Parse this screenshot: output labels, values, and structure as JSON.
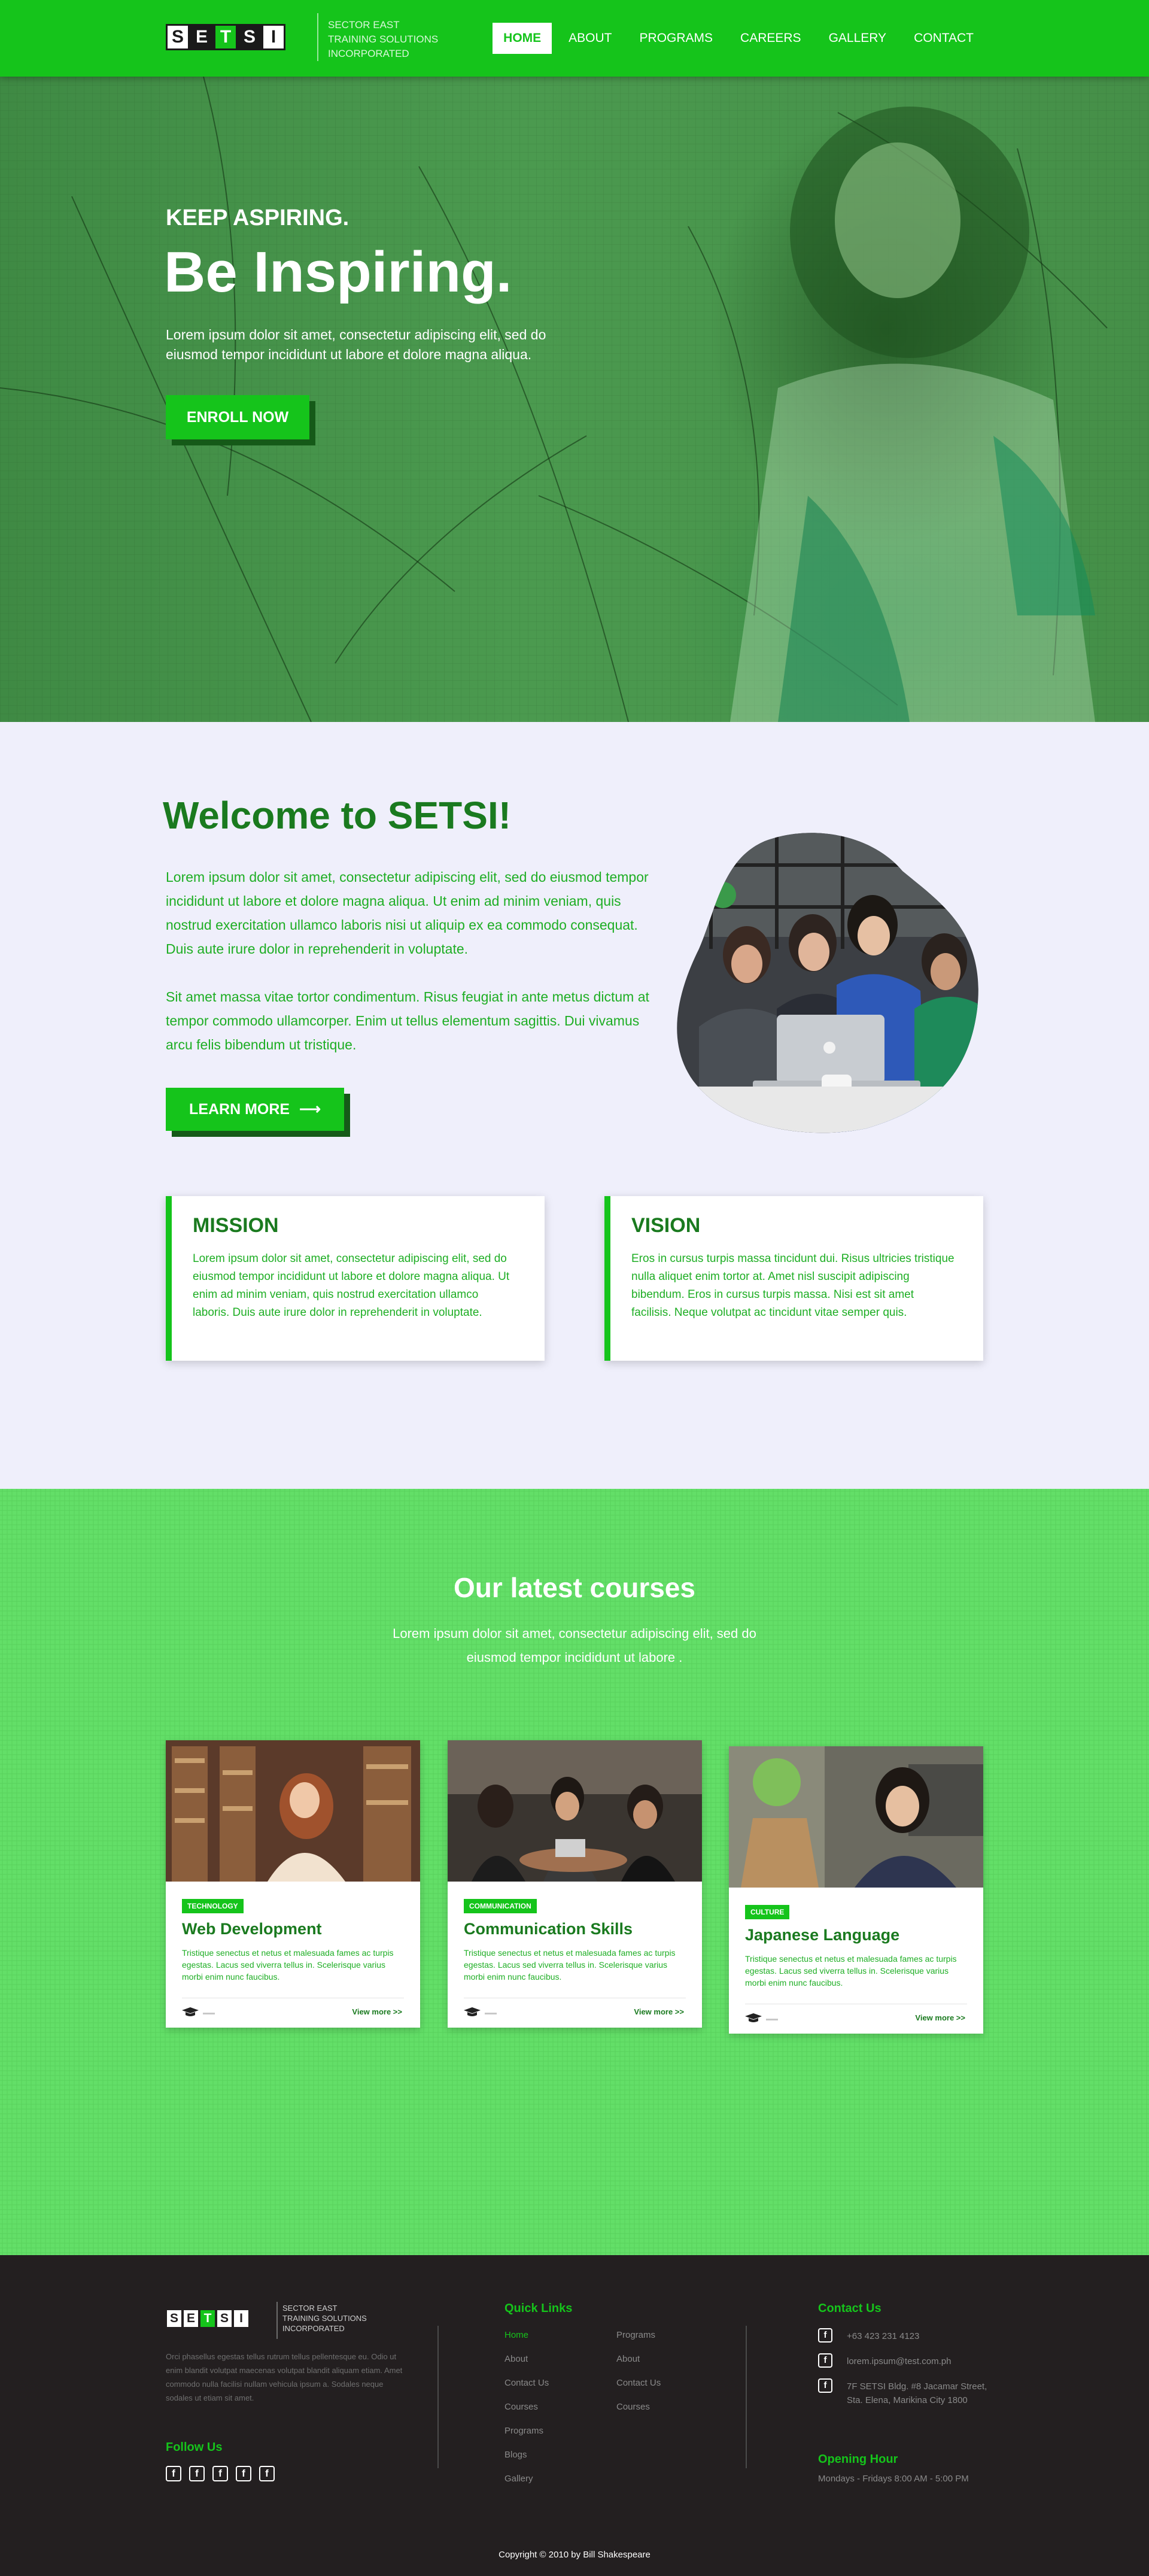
{
  "header": {
    "logo_letters": [
      "S",
      "E",
      "T",
      "S",
      "I"
    ],
    "tagline": [
      "SECTOR EAST",
      "TRAINING SOLUTIONS",
      "INCORPORATED"
    ],
    "nav": [
      {
        "label": "HOME",
        "active": true
      },
      {
        "label": "ABOUT",
        "active": false
      },
      {
        "label": "PROGRAMS",
        "active": false
      },
      {
        "label": "CAREERS",
        "active": false
      },
      {
        "label": "GALLERY",
        "active": false
      },
      {
        "label": "CONTACT",
        "active": false
      }
    ]
  },
  "hero": {
    "kicker": "KEEP ASPIRING.",
    "title": "Be Inspiring.",
    "text": "Lorem ipsum dolor sit amet, consectetur adipiscing elit, sed do eiusmod tempor incididunt ut labore et dolore magna aliqua.",
    "cta": "ENROLL NOW"
  },
  "welcome": {
    "title": "Welcome to SETSI!",
    "paragraph1": "Lorem ipsum dolor sit amet, consectetur adipiscing elit, sed do eiusmod tempor incididunt ut labore et dolore magna aliqua. Ut enim ad minim veniam, quis nostrud exercitation ullamco laboris nisi ut aliquip ex ea commodo consequat. Duis aute irure dolor in reprehenderit in voluptate.",
    "paragraph2": "Sit amet massa vitae tortor condimentum. Risus feugiat in ante metus dictum at tempor commodo ullamcorper. Enim ut tellus elementum sagittis. Dui vivamus arcu felis bibendum ut tristique.",
    "cta": "LEARN MORE",
    "cta_arrow": "⟶"
  },
  "mission": {
    "title": "MISSION",
    "text": "Lorem ipsum dolor sit amet, consectetur adipiscing elit, sed do eiusmod tempor incididunt ut labore et dolore magna aliqua. Ut enim ad minim veniam, quis nostrud exercitation ullamco laboris. Duis aute irure dolor in reprehenderit in voluptate."
  },
  "vision": {
    "title": "VISION",
    "text": "Eros in cursus turpis massa tincidunt dui. Risus ultricies tristique nulla aliquet enim tortor at. Amet nisl suscipit adipiscing bibendum. Eros in cursus turpis massa. Nisi est sit amet facilisis. Neque volutpat ac tincidunt vitae semper quis."
  },
  "courses": {
    "title": "Our latest courses",
    "subtitle": "Lorem ipsum dolor sit amet, consectetur adipiscing elit, sed do eiusmod tempor incididunt ut labore .",
    "items": [
      {
        "badge": "TECHNOLOGY",
        "title": "Web Development",
        "text": "Tristique senectus et netus et malesuada fames ac turpis egestas. Lacus sed viverra tellus in. Scelerisque varius morbi enim nunc faucibus.",
        "dots": "▬▬",
        "more": "View more >>"
      },
      {
        "badge": "COMMUNICATION",
        "title": "Communication Skills",
        "text": "Tristique senectus et netus et malesuada fames ac turpis egestas. Lacus sed viverra tellus in. Scelerisque varius morbi enim nunc faucibus.",
        "dots": "▬▬",
        "more": "View more >>"
      },
      {
        "badge": "CULTURE",
        "title": "Japanese Language",
        "text": "Tristique senectus et netus et malesuada fames ac turpis egestas. Lacus sed viverra tellus in. Scelerisque varius morbi enim nunc faucibus.",
        "dots": "▬▬",
        "more": "View more >>"
      }
    ]
  },
  "footer": {
    "about": "Orci phasellus egestas tellus rutrum tellus pellentesque eu. Odio ut enim blandit volutpat maecenas volutpat blandit aliquam etiam. Amet commodo nulla facilisi nullam vehicula ipsum a. Sodales neque sodales ut etiam sit amet.",
    "follow_title": "Follow Us",
    "social_icons": [
      "f",
      "f",
      "f",
      "f",
      "f"
    ],
    "quick_links_title": "Quick Links",
    "links_col1": [
      "Home",
      "About",
      "Contact Us",
      "Courses",
      "Programs",
      "Blogs",
      "Gallery"
    ],
    "links_col2": [
      "Programs",
      "About",
      "Contact Us",
      "Courses"
    ],
    "contact_title": "Contact Us",
    "contact_icon": "f",
    "phone": "+63 423 231 4123",
    "email": "lorem.ipsum@test.com.ph",
    "address_line1": "7F SETSI Bldg. #8 Jacamar Street,",
    "address_line2": "Sta. Elena, Marikina City 1800",
    "hours_title": "Opening Hour",
    "hours": "Mondays - Fridays 8:00 AM - 5:00 PM",
    "copyright": "Copyright © 2010 by Bill Shakespeare"
  }
}
